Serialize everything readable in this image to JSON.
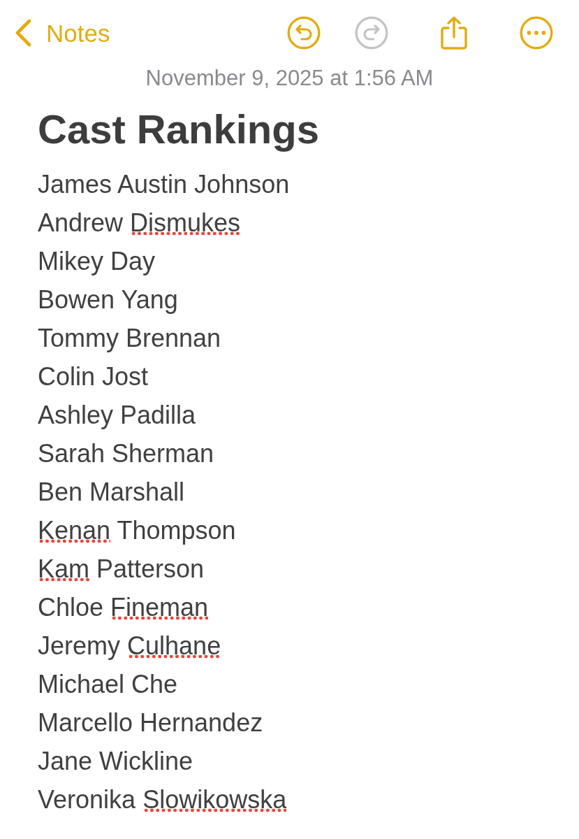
{
  "nav": {
    "back_label": "Notes"
  },
  "toolbar": [
    {
      "kind": "undo",
      "disabled": false
    },
    {
      "kind": "redo",
      "disabled": true
    },
    {
      "kind": "share",
      "disabled": false
    },
    {
      "kind": "more",
      "disabled": false
    }
  ],
  "note": {
    "date": "November 9, 2025 at 1:56 AM",
    "title": "Cast Rankings",
    "lines": [
      {
        "segments": [
          {
            "text": "James Austin Johnson",
            "misspelled": false
          }
        ]
      },
      {
        "segments": [
          {
            "text": "Andrew",
            "misspelled": false
          },
          {
            "text": "Dismukes",
            "misspelled": true
          }
        ]
      },
      {
        "segments": [
          {
            "text": "Mikey Day",
            "misspelled": false
          }
        ]
      },
      {
        "segments": [
          {
            "text": "Bowen Yang",
            "misspelled": false
          }
        ]
      },
      {
        "segments": [
          {
            "text": "Tommy Brennan",
            "misspelled": false
          }
        ]
      },
      {
        "segments": [
          {
            "text": "Colin Jost",
            "misspelled": false
          }
        ]
      },
      {
        "segments": [
          {
            "text": "Ashley Padilla",
            "misspelled": false
          }
        ]
      },
      {
        "segments": [
          {
            "text": "Sarah Sherman",
            "misspelled": false
          }
        ]
      },
      {
        "segments": [
          {
            "text": "Ben Marshall",
            "misspelled": false
          }
        ]
      },
      {
        "segments": [
          {
            "text": "Kenan",
            "misspelled": true
          },
          {
            "text": "Thompson",
            "misspelled": false
          }
        ]
      },
      {
        "segments": [
          {
            "text": "Kam",
            "misspelled": true
          },
          {
            "text": "Patterson",
            "misspelled": false
          }
        ]
      },
      {
        "segments": [
          {
            "text": "Chloe",
            "misspelled": false
          },
          {
            "text": "Fineman",
            "misspelled": true
          }
        ]
      },
      {
        "segments": [
          {
            "text": "Jeremy",
            "misspelled": false
          },
          {
            "text": "Culhane",
            "misspelled": true
          }
        ]
      },
      {
        "segments": [
          {
            "text": "Michael Che",
            "misspelled": false
          }
        ]
      },
      {
        "segments": [
          {
            "text": "Marcello Hernandez",
            "misspelled": false
          }
        ]
      },
      {
        "segments": [
          {
            "text": "Jane Wickline",
            "misspelled": false
          }
        ]
      },
      {
        "segments": [
          {
            "text": "Veronika",
            "misspelled": false
          },
          {
            "text": "Slowikowska",
            "misspelled": true
          }
        ]
      }
    ]
  }
}
